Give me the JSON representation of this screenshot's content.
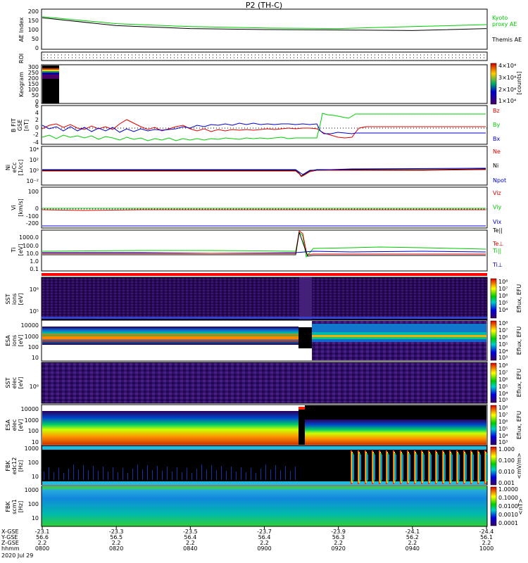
{
  "title": "P2 (TH-C)",
  "colors": {
    "black": "#000000",
    "green": "#00cc00",
    "red": "#dd0000",
    "blue": "#0000cc"
  },
  "panels": {
    "ae": {
      "ylabel": "AE Index",
      "yticks": [
        "200",
        "150",
        "100",
        "50",
        "0"
      ],
      "legend_kyoto": "Kyoto",
      "legend_proxy": "proxy AE",
      "legend_themis": "Themis AE"
    },
    "roi": {
      "ylabel": "ROI"
    },
    "keo": {
      "ylabel": "Keogram",
      "yticks": [
        "300",
        "250",
        "200",
        "150",
        "100",
        "50",
        "0"
      ],
      "cb_ticks": [
        "4×10⁴",
        "3×10⁴",
        "2×10⁴",
        "1×10⁴"
      ],
      "cb_label": "[counts]"
    },
    "bfield": {
      "ylabel": "B FIT",
      "ylabel2": "GSE",
      "ylabel3": "[nT]",
      "yticks": [
        "6",
        "4",
        "2",
        "0",
        "-2",
        "-4"
      ],
      "leg": [
        "Bz",
        "By",
        "Bx"
      ]
    },
    "ni": {
      "ylabel": "Ni",
      "ylabel2": "[1/cc]",
      "ylabel3": "eCc",
      "yticks": [
        "10⁴",
        "10²",
        "10⁰",
        "10⁻²"
      ],
      "leg": [
        "Ne",
        "Ni",
        "Npot"
      ]
    },
    "vi": {
      "ylabel": "Vi",
      "ylabel2": "[km/s]",
      "yticks": [
        "100",
        "0",
        "-100",
        "-200",
        "-300"
      ],
      "leg": [
        "Viz",
        "Viy",
        "Vix"
      ]
    },
    "ti": {
      "ylabel": "Ti",
      "ylabel2": "[eV]",
      "yticks": [
        "1000.0",
        "100.0",
        "10.0",
        "1.0",
        "0.1"
      ],
      "leg": [
        "Te||",
        "Te⊥",
        "Ti||",
        "Ti⊥"
      ]
    },
    "sst1": {
      "ylabel": "SST",
      "ylabel2": "ions",
      "ylabel3": "[eV]",
      "yticks": [
        "10⁶",
        "10⁵"
      ],
      "cb_ticks": [
        "10⁸",
        "10⁷",
        "10⁶",
        "10⁵",
        "10⁴",
        "10³"
      ],
      "cb_label": "Eflux, EFU"
    },
    "esa1": {
      "ylabel": "ESA",
      "ylabel2": "ions",
      "ylabel3": "[eV]",
      "yticks": [
        "10000",
        "1000",
        "100",
        "10"
      ],
      "cb_ticks": [
        "10⁸",
        "10⁷",
        "10⁶",
        "10⁵",
        "10⁴",
        "10³"
      ],
      "cb_label": "Eflux, EFU"
    },
    "sst2": {
      "ylabel": "SST",
      "ylabel2": "elec",
      "ylabel3": "[eV]",
      "yticks": [
        "10⁶"
      ],
      "cb_ticks": [
        "10⁸",
        "10⁷",
        "10⁶",
        "10⁵",
        "10⁴",
        "10³"
      ],
      "cb_label": "Eflux, EFU"
    },
    "esa2": {
      "ylabel": "ESA",
      "ylabel2": "elec",
      "ylabel3": "[eV]",
      "yticks": [
        "10000",
        "1000",
        "100",
        "10"
      ],
      "cb_ticks": [
        "10⁸",
        "10⁷",
        "10⁶",
        "10⁵",
        "10⁴",
        "10³"
      ],
      "cb_label": "Eflux, EFU"
    },
    "fbk1": {
      "ylabel": "FBK",
      "ylabel2": "edc12",
      "ylabel3": "[Hz]",
      "yticks": [
        "1000",
        "100",
        "10"
      ],
      "cb_ticks": [
        "1.000",
        "0.100",
        "0.010",
        "0.001"
      ],
      "cb_label": "<mV/m>"
    },
    "fbk2": {
      "ylabel": "FBK",
      "ylabel2": "scm1",
      "ylabel3": "[Hz]",
      "yticks": [
        "1000",
        "100",
        "10"
      ],
      "cb_ticks": [
        "1.0000",
        "0.1000",
        "0.0100",
        "0.0010",
        "0.0001"
      ],
      "cb_label": "<nT>"
    }
  },
  "xaxis": {
    "row_labels": [
      "X-GSE",
      "Y-GSE",
      "Z-GSE",
      "hhmm",
      "2020 Jul 29"
    ],
    "ticks": [
      {
        "x": "-23.1",
        "y": "56.6",
        "z": "2.2",
        "t": "0800"
      },
      {
        "x": "-23.3",
        "y": "56.5",
        "z": "2.2",
        "t": "0820"
      },
      {
        "x": "-23.5",
        "y": "56.4",
        "z": "2.2",
        "t": "0840"
      },
      {
        "x": "-23.7",
        "y": "56.4",
        "z": "2.2",
        "t": "0900"
      },
      {
        "x": "-23.9",
        "y": "56.3",
        "z": "2.2",
        "t": "0920"
      },
      {
        "x": "-24.1",
        "y": "56.2",
        "z": "2.2",
        "t": "0940"
      },
      {
        "x": "-24.4",
        "y": "56.1",
        "z": "2.2",
        "t": "1000"
      }
    ]
  },
  "chart_data": {
    "type": "line",
    "title": "P2 (TH-C)",
    "x_time": [
      "0800",
      "0820",
      "0840",
      "0900",
      "0920",
      "0940",
      "1000"
    ],
    "series": [
      {
        "name": "Kyoto proxy AE",
        "y": [
          165,
          130,
          115,
          108,
          105,
          115,
          125
        ]
      },
      {
        "name": "Themis AE",
        "y": [
          160,
          120,
          105,
          100,
          98,
          95,
          105
        ]
      }
    ],
    "ylim": [
      0,
      200
    ]
  }
}
